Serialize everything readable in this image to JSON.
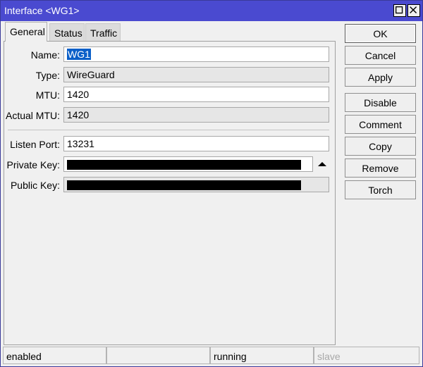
{
  "window": {
    "title": "Interface <WG1>"
  },
  "tabs": [
    {
      "label": "General"
    },
    {
      "label": "Status"
    },
    {
      "label": "Traffic"
    }
  ],
  "fields": {
    "name": {
      "label": "Name:",
      "value": "WG1"
    },
    "type": {
      "label": "Type:",
      "value": "WireGuard"
    },
    "mtu": {
      "label": "MTU:",
      "value": "1420"
    },
    "actual_mtu": {
      "label": "Actual MTU:",
      "value": "1420"
    },
    "listen_port": {
      "label": "Listen Port:",
      "value": "13231"
    },
    "private_key": {
      "label": "Private Key:",
      "value": ""
    },
    "public_key": {
      "label": "Public Key:",
      "value": ""
    }
  },
  "buttons": {
    "ok": "OK",
    "cancel": "Cancel",
    "apply": "Apply",
    "disable": "Disable",
    "comment": "Comment",
    "copy": "Copy",
    "remove": "Remove",
    "torch": "Torch"
  },
  "status_bar": {
    "state": "enabled",
    "empty": "",
    "running": "running",
    "slave": "slave"
  },
  "colors": {
    "titlebar": "#4a4ad0",
    "selection": "#0a5fc8"
  },
  "icons": {
    "maximize": "maximize-icon",
    "close": "close-icon",
    "collapse": "triangle-up-icon"
  }
}
